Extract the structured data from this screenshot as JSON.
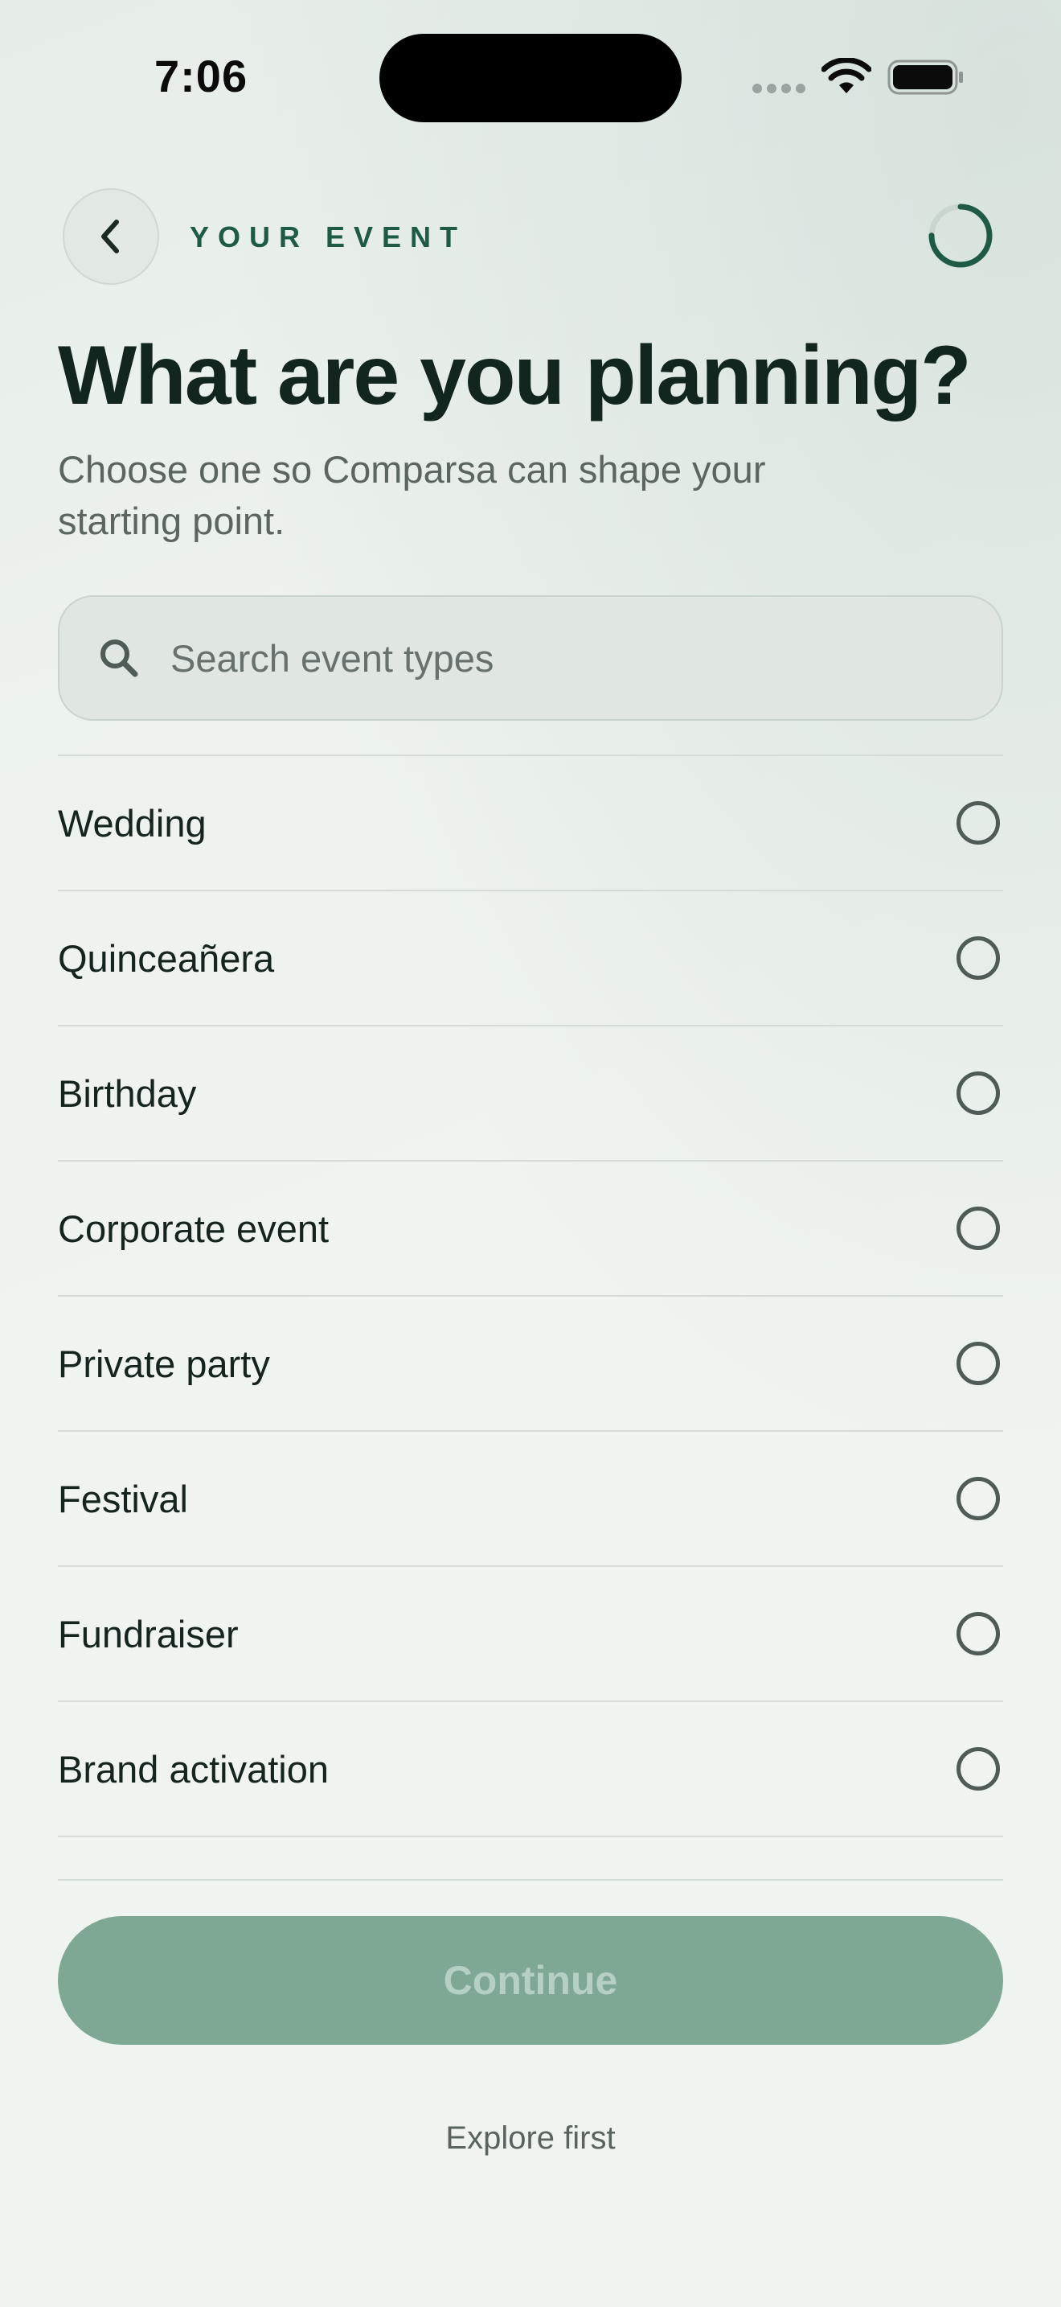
{
  "status_bar": {
    "time": "7:06"
  },
  "header": {
    "eyebrow": "YOUR EVENT",
    "back_icon": "chevron-left-icon",
    "progress_icon": "progress-ring-icon",
    "progress": 0.75
  },
  "main": {
    "title": "What are you planning?",
    "subtitle": "Choose one so Comparsa can shape your starting point."
  },
  "search": {
    "placeholder": "Search event types",
    "value": "",
    "icon": "search-icon"
  },
  "event_types": [
    {
      "label": "Wedding",
      "selected": false
    },
    {
      "label": "Quinceañera",
      "selected": false
    },
    {
      "label": "Birthday",
      "selected": false
    },
    {
      "label": "Corporate event",
      "selected": false
    },
    {
      "label": "Private party",
      "selected": false
    },
    {
      "label": "Festival",
      "selected": false
    },
    {
      "label": "Fundraiser",
      "selected": false
    },
    {
      "label": "Brand activation",
      "selected": false
    }
  ],
  "footer": {
    "continue_label": "Continue",
    "continue_enabled": false,
    "explore_label": "Explore first"
  },
  "colors": {
    "accent": "#1f5a47",
    "button_disabled": "#7fa894",
    "background": "#f0f4f0"
  }
}
